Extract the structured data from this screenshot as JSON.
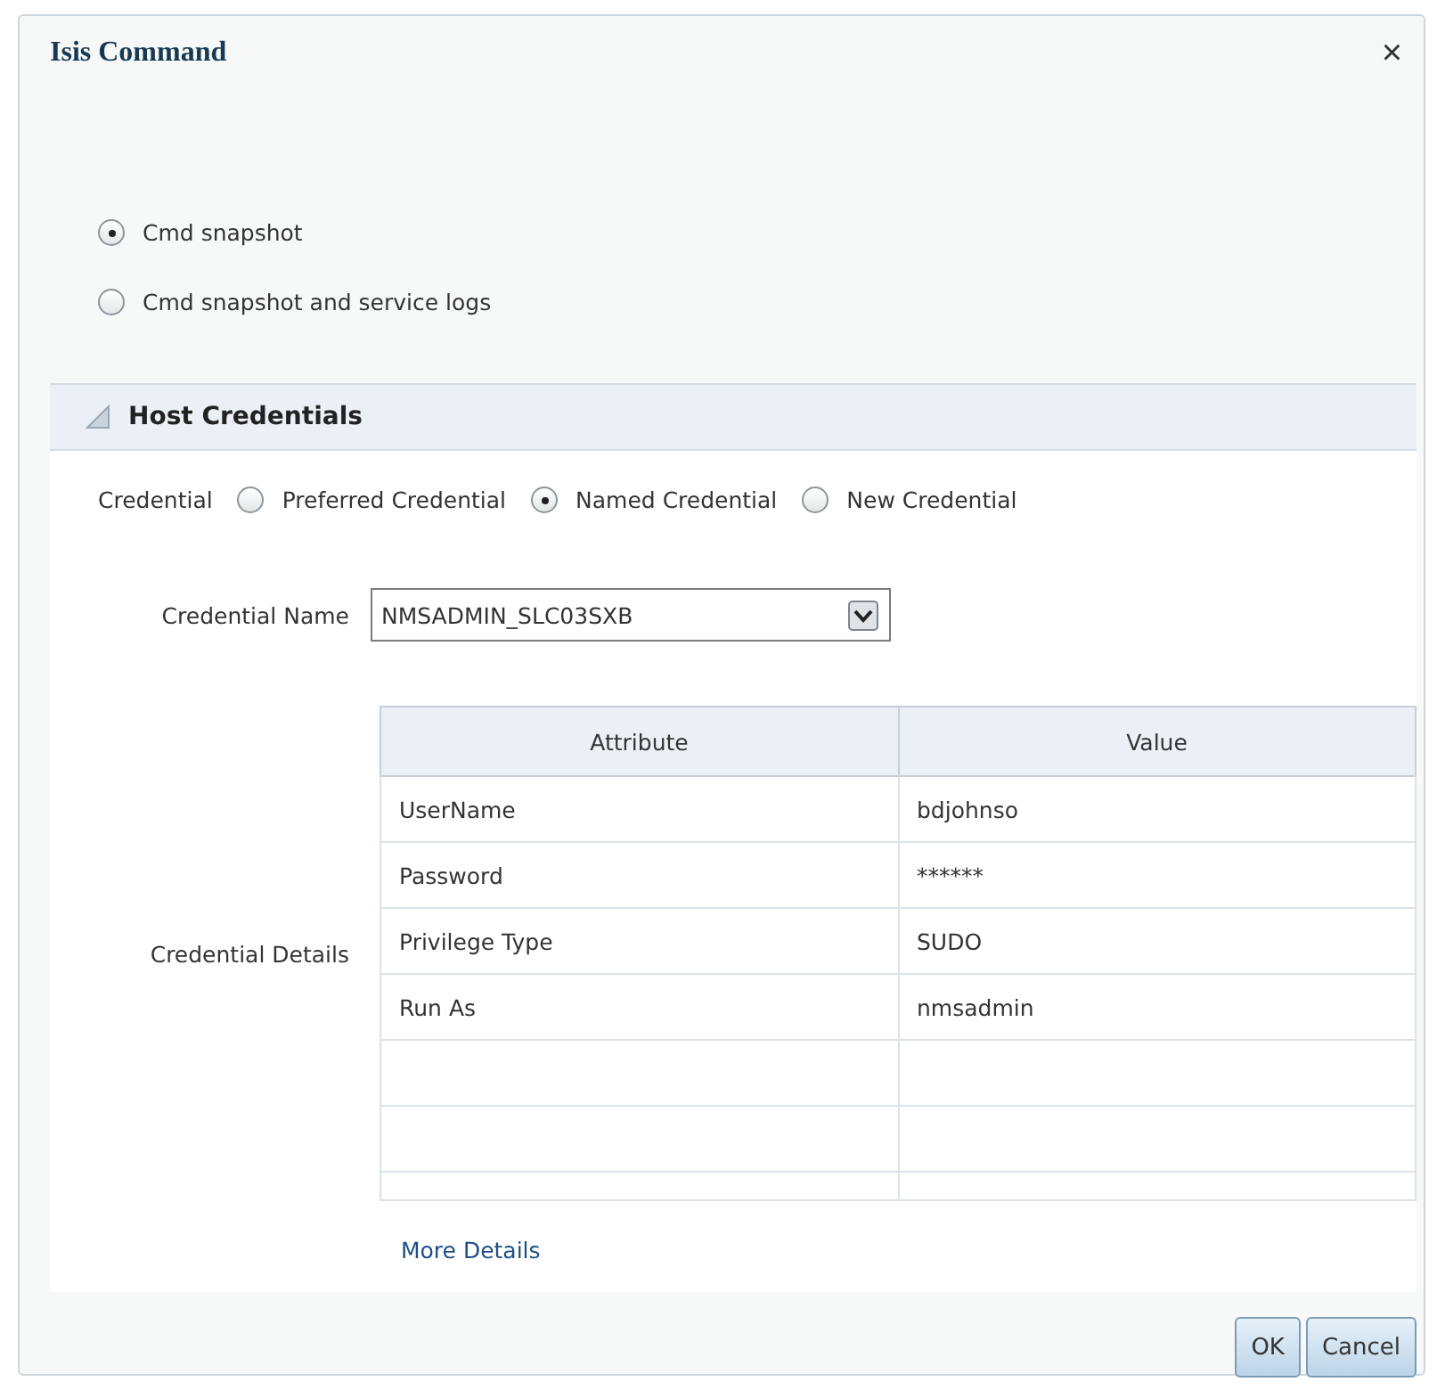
{
  "dialog": {
    "title": "Isis Command",
    "close": "×"
  },
  "options": [
    {
      "label": "Cmd snapshot",
      "selected": true
    },
    {
      "label": "Cmd snapshot and service logs",
      "selected": false
    }
  ],
  "section": {
    "title": "Host Credentials",
    "expanded": true
  },
  "credential": {
    "label": "Credential",
    "choices": [
      {
        "label": "Preferred Credential",
        "selected": false
      },
      {
        "label": "Named Credential",
        "selected": true
      },
      {
        "label": "New Credential",
        "selected": false
      }
    ]
  },
  "credential_name": {
    "label": "Credential Name",
    "value": "NMSADMIN_SLC03SXB"
  },
  "details": {
    "label": "Credential Details",
    "columns": [
      "Attribute",
      "Value"
    ],
    "rows": [
      [
        "UserName",
        "bdjohnso"
      ],
      [
        "Password",
        "******"
      ],
      [
        "Privilege Type",
        "SUDO"
      ],
      [
        "Run As",
        "nmsadmin"
      ]
    ]
  },
  "link": "More Details",
  "buttons": [
    "OK",
    "Cancel"
  ]
}
